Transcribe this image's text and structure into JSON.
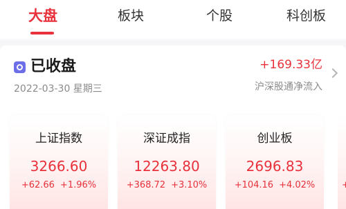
{
  "tabs": [
    {
      "label": "大盘",
      "active": true
    },
    {
      "label": "板块",
      "active": false
    },
    {
      "label": "个股",
      "active": false
    },
    {
      "label": "科创板",
      "active": false
    }
  ],
  "status": {
    "icon": "status-icon",
    "title": "已收盘",
    "date": "2022-03-30 星期三",
    "inflow_value": "+169.33亿",
    "inflow_label": "沪深股通净流入"
  },
  "indices": [
    {
      "name": "上证指数",
      "value": "3266.60",
      "change": "+62.66",
      "change_pct": "+1.96%"
    },
    {
      "name": "深证成指",
      "value": "12263.80",
      "change": "+368.72",
      "change_pct": "+3.10%"
    },
    {
      "name": "创业板",
      "value": "2696.83",
      "change": "+104.16",
      "change_pct": "+4.02%"
    }
  ],
  "partial_index": {
    "change": "+"
  },
  "colors": {
    "accent": "#e8313b",
    "text": "#222222",
    "muted": "#8a8a8a",
    "icon": "#6c6fe8"
  }
}
